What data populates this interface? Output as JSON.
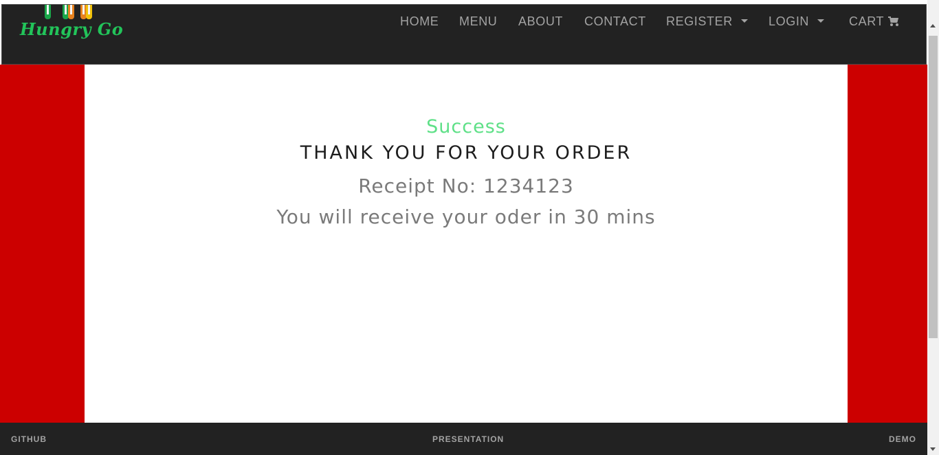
{
  "brand": {
    "name": "Hungry Go"
  },
  "nav": {
    "home": "HOME",
    "menu": "MENU",
    "about": "ABOUT",
    "contact": "CONTACT",
    "register": "REGISTER",
    "login": "LOGIN",
    "cart": "CART"
  },
  "order": {
    "status": "Success",
    "headline": "THANK YOU FOR YOUR ORDER",
    "receipt": "Receipt No: 1234123",
    "eta": "You will receive your oder in 30 mins"
  },
  "footer": {
    "github": "GITHUB",
    "presentation": "PRESENTATION",
    "demo": "DEMO"
  },
  "icons": {
    "cart": "shopping-cart-icon",
    "register_caret": "caret-down-icon",
    "login_caret": "caret-down-icon"
  },
  "colors": {
    "navbar": "#222222",
    "side_panels": "#cc0000",
    "success": "#5ee087",
    "logo_text": "#22c45a",
    "nav_text": "#a3a3a3"
  }
}
